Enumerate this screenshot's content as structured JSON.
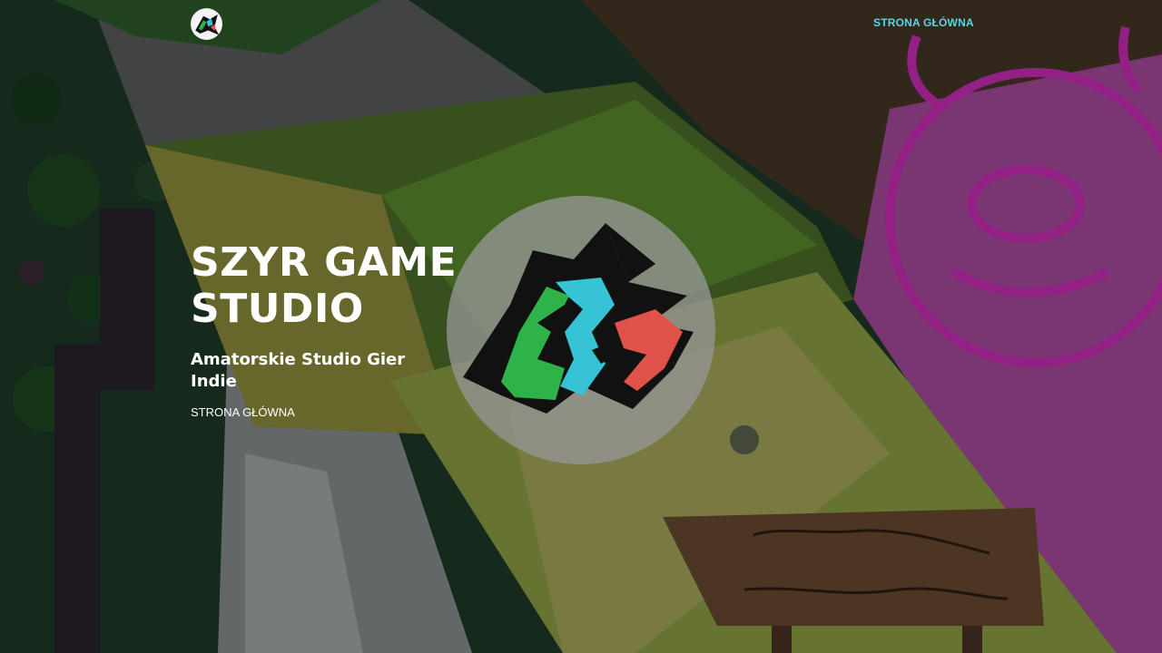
{
  "nav": {
    "logo_icon": "szyr-game-studio-logo-icon",
    "home_link": "STRONA GŁÓWNA"
  },
  "hero": {
    "title": "SZYR GAME STUDIO",
    "subtitle": "Amatorskie Studio Gier Indie",
    "breadcrumb": "STRONA GŁÓWNA",
    "emblem_icon": "szyr-game-studio-logo-icon",
    "sign_text": "North-tales of Ulkwood"
  },
  "colors": {
    "nav_link": "#5fd3e6",
    "logo_green": "#2db34a",
    "logo_cyan": "#36c3d6",
    "logo_red": "#e0524a",
    "logo_black": "#111111"
  }
}
